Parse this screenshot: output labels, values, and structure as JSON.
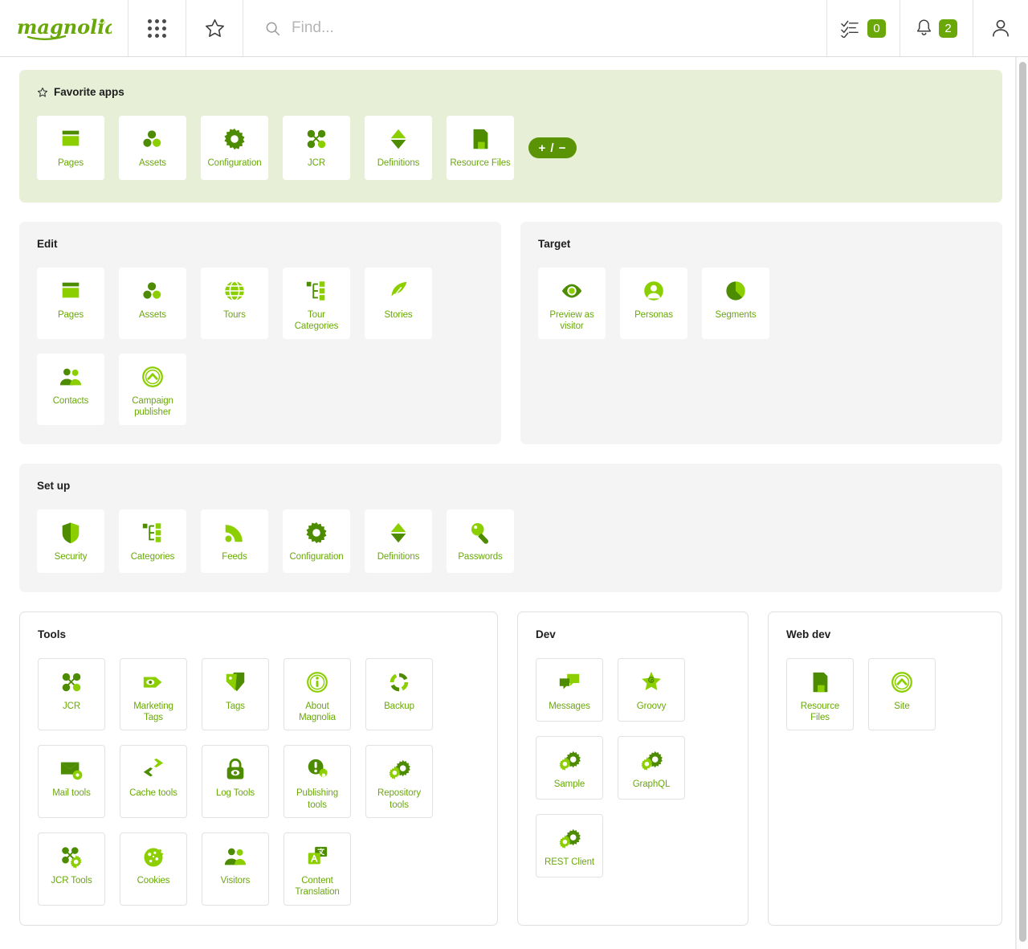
{
  "header": {
    "logo_text": "magnolia",
    "logo_registered": "®",
    "apps_icon": "app-grid-icon",
    "favorites_icon": "star-icon",
    "search": {
      "placeholder": "Find...",
      "value": "",
      "icon": "search-icon"
    },
    "tasks": {
      "icon": "tasks-checklist-icon",
      "count": "0"
    },
    "notifications": {
      "icon": "bell-icon",
      "count": "2"
    },
    "user": {
      "icon": "user-avatar-icon"
    }
  },
  "favorites": {
    "title": "Favorite apps",
    "icon": "star-outline-icon",
    "toggle_label": "+ / −",
    "apps": [
      {
        "label": "Pages",
        "icon": "pages-icon"
      },
      {
        "label": "Assets",
        "icon": "assets-icon"
      },
      {
        "label": "Configuration",
        "icon": "gear-icon"
      },
      {
        "label": "JCR",
        "icon": "jcr-nodes-icon"
      },
      {
        "label": "Definitions",
        "icon": "definitions-diamond-icon"
      },
      {
        "label": "Resource Files",
        "icon": "resource-files-icon"
      }
    ]
  },
  "groups": [
    {
      "key": "edit",
      "title": "Edit",
      "style": "grey",
      "apps": [
        {
          "label": "Pages",
          "icon": "pages-icon"
        },
        {
          "label": "Assets",
          "icon": "assets-icon"
        },
        {
          "label": "Tours",
          "icon": "globe-icon"
        },
        {
          "label": "Tour Categories",
          "icon": "categories-tree-icon"
        },
        {
          "label": "Stories",
          "icon": "feather-icon"
        },
        {
          "label": "Contacts",
          "icon": "contacts-people-icon"
        },
        {
          "label": "Campaign publisher",
          "icon": "circle-chevron-up-icon"
        }
      ]
    },
    {
      "key": "target",
      "title": "Target",
      "style": "grey",
      "apps": [
        {
          "label": "Preview as visitor",
          "icon": "eye-icon"
        },
        {
          "label": "Personas",
          "icon": "persona-avatar-icon"
        },
        {
          "label": "Segments",
          "icon": "pie-chart-icon"
        }
      ]
    },
    {
      "key": "setup",
      "title": "Set up",
      "style": "grey",
      "apps": [
        {
          "label": "Security",
          "icon": "shield-icon"
        },
        {
          "label": "Categories",
          "icon": "categories-tree-icon"
        },
        {
          "label": "Feeds",
          "icon": "rss-feed-icon"
        },
        {
          "label": "Configuration",
          "icon": "gear-icon"
        },
        {
          "label": "Definitions",
          "icon": "definitions-diamond-icon"
        },
        {
          "label": "Passwords",
          "icon": "key-icon"
        }
      ]
    },
    {
      "key": "tools",
      "title": "Tools",
      "style": "white",
      "apps": [
        {
          "label": "JCR",
          "icon": "jcr-nodes-icon"
        },
        {
          "label": "Marketing Tags",
          "icon": "marketing-tag-eye-icon"
        },
        {
          "label": "Tags",
          "icon": "tags-icon"
        },
        {
          "label": "About Magnolia",
          "icon": "info-circle-icon"
        },
        {
          "label": "Backup",
          "icon": "backup-refresh-icon"
        },
        {
          "label": "Mail tools",
          "icon": "mail-gear-icon"
        },
        {
          "label": "Cache tools",
          "icon": "cache-arrows-icon"
        },
        {
          "label": "Log Tools",
          "icon": "lock-eye-icon"
        },
        {
          "label": "Publishing tools",
          "icon": "publishing-gear-icon"
        },
        {
          "label": "Repository tools",
          "icon": "gears-icon"
        },
        {
          "label": "JCR Tools",
          "icon": "jcr-gear-icon"
        },
        {
          "label": "Cookies",
          "icon": "cookie-icon"
        },
        {
          "label": "Visitors",
          "icon": "contacts-people-icon"
        },
        {
          "label": "Content Translation",
          "icon": "translate-icon"
        }
      ]
    },
    {
      "key": "dev",
      "title": "Dev",
      "style": "white",
      "apps": [
        {
          "label": "Messages",
          "icon": "chat-bubbles-icon"
        },
        {
          "label": "Groovy",
          "icon": "groovy-star-icon"
        },
        {
          "label": "Sample",
          "icon": "gears-icon"
        },
        {
          "label": "GraphQL",
          "icon": "gears-icon"
        },
        {
          "label": "REST Client",
          "icon": "gears-icon"
        }
      ]
    },
    {
      "key": "webdev",
      "title": "Web dev",
      "style": "white",
      "apps": [
        {
          "label": "Resource Files",
          "icon": "resource-files-icon"
        },
        {
          "label": "Site",
          "icon": "circle-chevron-up-icon"
        }
      ]
    }
  ],
  "colors": {
    "brand_green": "#6aa80a",
    "dark_green": "#4d8b00",
    "light_green": "#8ccf00",
    "favorites_band": "#e7efd7",
    "panel_grey": "#f4f4f4",
    "badge_green": "#6aa80a"
  }
}
